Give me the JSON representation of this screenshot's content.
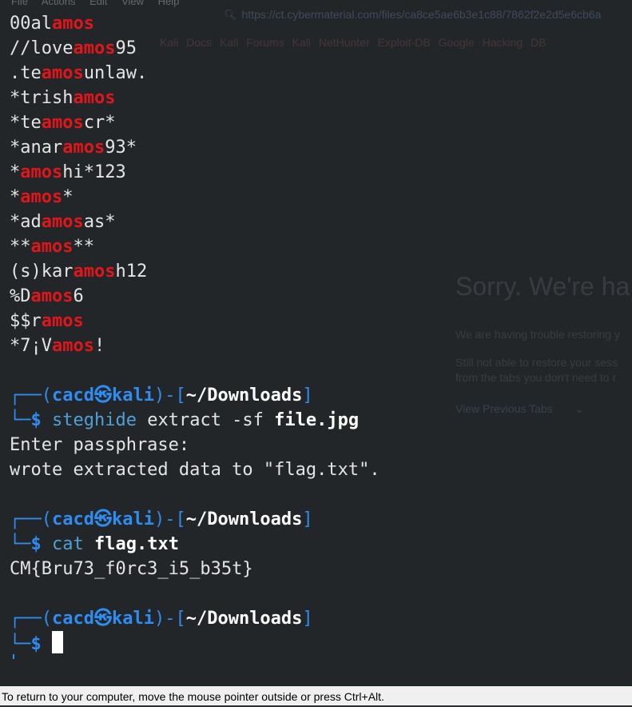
{
  "background_app": {
    "menu": "File Actions Edit View Help",
    "url": "https://ct.cybermaterial.com/files/ca8ce5ae6b3e1c88/7862f2e2d5e6cb6a",
    "bookmarks": "Kali Docs  Kali Forums  Kali NetHunter  Exploit-DB  Google Hacking DB",
    "heading": "Sorry. We're ha",
    "trouble_text": "We are having trouble restoring y",
    "still_text_1": "Still not able to restore your sess",
    "still_text_2": "from the tabs you don't need to r",
    "view_tabs": "View Previous Tabs"
  },
  "terminal": {
    "wordlist": [
      {
        "pre": "00al",
        "hl": "amos",
        "post": ""
      },
      {
        "pre": "//love",
        "hl": "amos",
        "post": "95"
      },
      {
        "pre": ".te",
        "hl": "amos",
        "post": "unlaw."
      },
      {
        "pre": "*trish",
        "hl": "amos",
        "post": ""
      },
      {
        "pre": "*te",
        "hl": "amos",
        "post": "cr*"
      },
      {
        "pre": "*anar",
        "hl": "amos",
        "post": "93*"
      },
      {
        "pre": "*",
        "hl": "amos",
        "post": "hi*123"
      },
      {
        "pre": "*",
        "hl": "amos",
        "post": "*"
      },
      {
        "pre": "*ad",
        "hl": "amos",
        "post": "as*"
      },
      {
        "pre": "**",
        "hl": "amos",
        "post": "**"
      },
      {
        "pre": "(s)kar",
        "hl": "amos",
        "post": "h12"
      },
      {
        "pre": "%D",
        "hl": "amos",
        "post": "6"
      },
      {
        "pre": "$$r",
        "hl": "amos",
        "post": ""
      },
      {
        "pre": "*7¡V",
        "hl": "amos",
        "post": "!"
      }
    ],
    "prompt": {
      "corner_top": "┌──(",
      "user": "cacd",
      "skull": "㉿",
      "host": "kali",
      "mid": ")-[",
      "path": "~/Downloads",
      "close": "]",
      "corner_bottom": "└─",
      "dollar": "$"
    },
    "cmd1": {
      "cmd": "steghide",
      "args": "extract -sf",
      "file": "file.jpg"
    },
    "out1": [
      "Enter passphrase:",
      "wrote extracted data to \"flag.txt\"."
    ],
    "cmd2": {
      "cmd": "cat",
      "file": "flag.txt"
    },
    "out2": "CM{Bru73_f0rc3_i5_b35t}"
  },
  "statusbar": {
    "text": "To return to your computer, move the mouse pointer outside or press Ctrl+Alt."
  },
  "colors": {
    "terminal_bg": "#232629",
    "highlight": "#e0161a",
    "prompt_blue": "#2f8cf0",
    "command_cyan": "#4aa5c9"
  }
}
